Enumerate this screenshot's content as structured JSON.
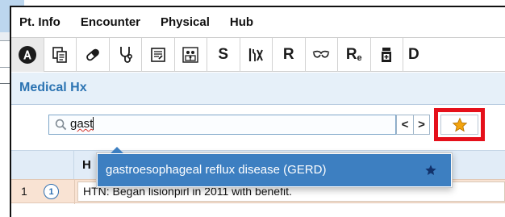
{
  "menu": [
    {
      "label": "Pt. Info"
    },
    {
      "label": "Encounter"
    },
    {
      "label": "Physical"
    },
    {
      "label": "Hub"
    }
  ],
  "toolbar": [
    {
      "icon": "a-circle-icon",
      "text": ""
    },
    {
      "icon": "copy-docs-icon",
      "text": ""
    },
    {
      "icon": "pill-icon",
      "text": ""
    },
    {
      "icon": "stethoscope-icon",
      "text": ""
    },
    {
      "icon": "notepad-icon",
      "text": ""
    },
    {
      "icon": "family-icon",
      "text": ""
    },
    {
      "icon": "s-letter-icon",
      "text": "S"
    },
    {
      "icon": "tools-icon",
      "text": ""
    },
    {
      "icon": "r-letter-icon",
      "text": "R"
    },
    {
      "icon": "eyeglasses-icon",
      "text": ""
    },
    {
      "icon": "re-letter-icon",
      "text": "R",
      "sub": "e"
    },
    {
      "icon": "medicine-bottle-icon",
      "text": ""
    },
    {
      "icon": "d-letter-icon",
      "text": "D"
    }
  ],
  "section": {
    "title": "Medical Hx"
  },
  "search": {
    "value": "gast"
  },
  "nav": {
    "prev": "<",
    "next": ">"
  },
  "grid": {
    "column_header": "H",
    "rows": [
      {
        "number": "1",
        "icon_glyph": "1",
        "text": "HTN: Began lisionpirl in 2011 with benefit."
      }
    ]
  },
  "autocomplete": {
    "items": [
      {
        "label": "gastroesophageal reflux disease (GERD)",
        "favorited": true
      }
    ]
  },
  "colors": {
    "accent": "#3d7fc1",
    "header_bg": "#e6f0f9",
    "row_bg": "#f9e3d3",
    "highlight_box": "#e5101a",
    "favorite_star": "#f3a40e"
  }
}
